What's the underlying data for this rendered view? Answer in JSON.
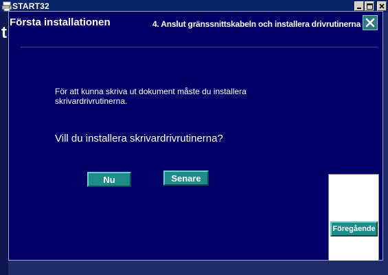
{
  "window": {
    "title": "START32",
    "icons": {
      "app": "printer-icon",
      "minimize": "minimize-icon",
      "maximize": "maximize-icon",
      "close": "close-icon"
    },
    "background_letter": "t"
  },
  "dialog": {
    "title": "Första installationen",
    "step": "4. Anslut gränssnittskabeln och installera drivrutinerna",
    "close_icon": "close-x-icon",
    "message": "För att kunna skriva ut dokument måste du installera skrivardrivrutinerna.",
    "question": "Vill du installera skrivardrivrutinerna?",
    "buttons": {
      "now": "Nu",
      "later": "Senare",
      "previous": "Föregående"
    }
  },
  "colors": {
    "dialog_bg": "#000066",
    "titlebar": "#0a246a",
    "button_teal": "#1f8c8a",
    "close_button": "#2f7a82"
  }
}
